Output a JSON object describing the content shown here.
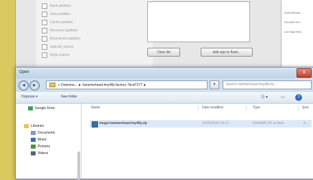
{
  "background_window": {
    "checkbox_labels": [
      "Bash partition",
      "Data partition",
      "Cache partition",
      "Recovery partition",
      "Boot kernel partition",
      "android_secure",
      "Wipe system"
    ],
    "clear_button": "Clear list",
    "add_button": "Add zips to flash...",
    "right_lines": [
      "...",
      "Android/Data...",
      "FACDEF4G1..",
      "com.flap.Hbid.."
    ]
  },
  "dialog": {
    "title": "Open",
    "close_label": "X",
    "back_label": "◄",
    "forward_label": "►",
    "address": "« Downloa... ► hammerhead-lmy48y-factory-7bcd7277 ►",
    "address_dropdown": "▾",
    "search_placeholder": "Search hammerhead-lmy48y-fa...",
    "toolbar": {
      "organize": "Organize ▾",
      "new_folder": "New folder",
      "view_label": "☷ ▾",
      "pane_label": "▭",
      "help_label": "?"
    },
    "nav_items": [
      {
        "label": "Google Drive",
        "icon": "google-drive-icon",
        "color": "#34a853"
      },
      {
        "label": "Libraries",
        "icon": "libraries-icon",
        "color": "#e8c35a"
      },
      {
        "label": "Documents",
        "icon": "documents-icon",
        "color": "#7d9cc4"
      },
      {
        "label": "Music",
        "icon": "music-icon",
        "color": "#3a6db3"
      },
      {
        "label": "Pictures",
        "icon": "pictures-icon",
        "color": "#4f8f3a"
      },
      {
        "label": "Videos",
        "icon": "videos-icon",
        "color": "#5a5f8a"
      }
    ],
    "columns": [
      "Name",
      "Date modified",
      "Type",
      "Size"
    ],
    "files": [
      {
        "name": "image-hammerhead-lmy48y.zip",
        "date": "22/05/2015 19:11",
        "type": "WinRAR ZIP archive",
        "size": "4..."
      }
    ]
  },
  "colors": {
    "backdrop": "#d9c95e",
    "dialog_frame": "#cfe0ef",
    "selection": "#dbe9f8"
  }
}
